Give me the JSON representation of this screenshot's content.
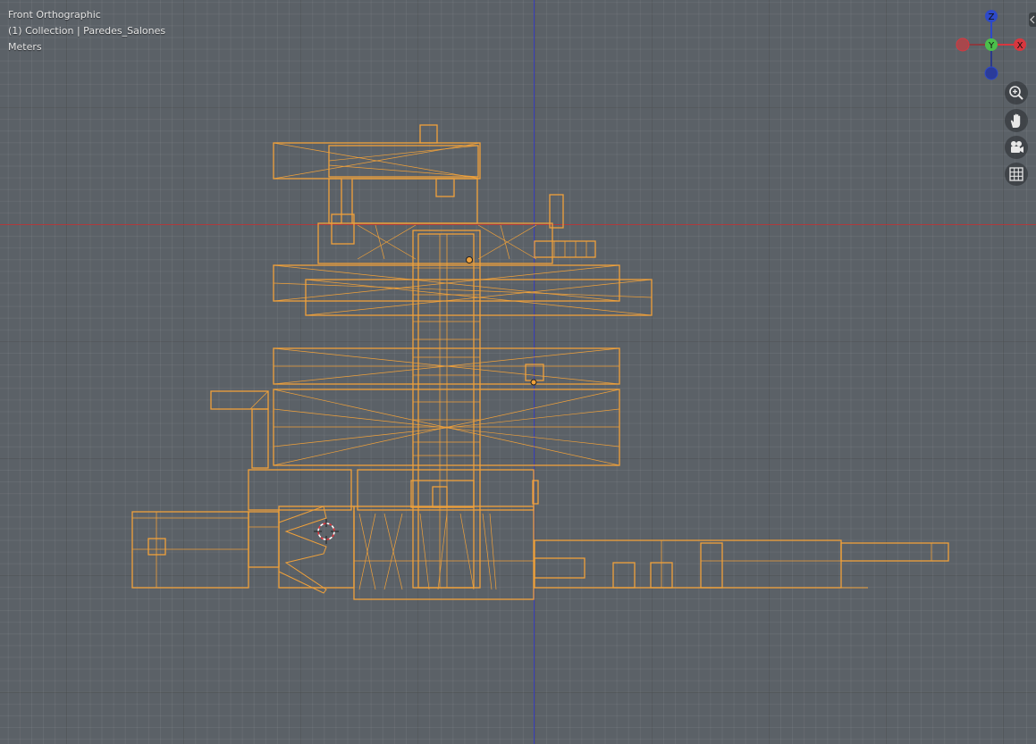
{
  "viewport": {
    "view_name": "Front Orthographic",
    "collection_info": "(1) Collection | Paredes_Salones",
    "units": "Meters"
  },
  "gizmo": {
    "z_label": "Z",
    "y_label": "Y",
    "x_label": "X",
    "colors": {
      "x": "#d8373f",
      "y": "#4bbf4b",
      "z": "#2d49c9"
    }
  },
  "nav_buttons": [
    "zoom-icon",
    "hand-pan-icon",
    "camera-icon",
    "grid-icon"
  ],
  "colors": {
    "background": "#5b6167",
    "wireframe": "#f0a13a",
    "x_axis": "#b0393c",
    "z_axis": "#3a3fbf"
  }
}
